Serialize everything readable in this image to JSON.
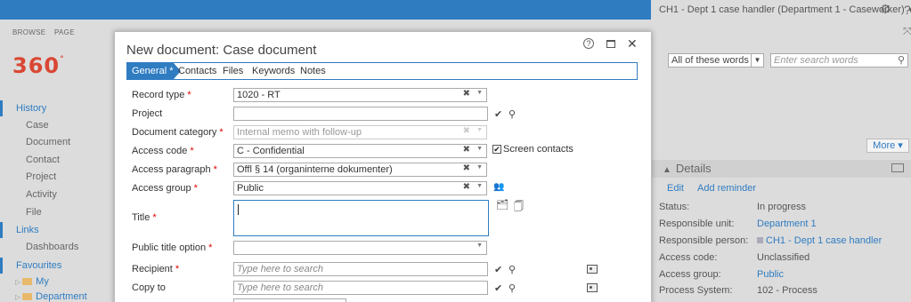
{
  "header": {
    "user_menu": "CH1 - Dept 1 case handler (Department 1 - Caseworker)"
  },
  "ribbon": {
    "tabs": [
      "BROWSE",
      "PAGE"
    ]
  },
  "logo": {
    "text": "360",
    "mark": "°"
  },
  "nav": {
    "history": {
      "label": "History",
      "items": [
        "Case",
        "Document",
        "Contact",
        "Project",
        "Activity",
        "File"
      ]
    },
    "links": {
      "label": "Links",
      "items": [
        "Dashboards"
      ]
    },
    "favourites": {
      "label": "Favourites",
      "items": [
        "My",
        "Department"
      ]
    }
  },
  "search": {
    "mode": "All of these words",
    "placeholder": "Enter search words"
  },
  "more_label": "More",
  "details": {
    "title": "Details",
    "actions": [
      "Edit",
      "Add reminder"
    ],
    "properties": [
      {
        "label": "Status:",
        "value": "In progress"
      },
      {
        "label": "Responsible unit:",
        "value": "Department 1"
      },
      {
        "label": "Responsible person:",
        "value": "CH1 - Dept 1 case handler"
      },
      {
        "label": "Access code:",
        "value": "Unclassified"
      },
      {
        "label": "Access group:",
        "value": "Public"
      },
      {
        "label": "Process System:",
        "value": "102 - Process"
      }
    ]
  },
  "modal": {
    "title": "New document: Case document",
    "tabs": [
      "General *",
      "Contacts",
      "Files",
      "Keywords",
      "Notes"
    ],
    "fields": {
      "record_type": {
        "label": "Record type",
        "value": "1020 - RT"
      },
      "project": {
        "label": "Project",
        "value": ""
      },
      "document_category": {
        "label": "Document category",
        "value": "Internal memo with follow-up"
      },
      "access_code": {
        "label": "Access code",
        "value": "C - Confidential"
      },
      "screen_contacts": {
        "label": "Screen contacts",
        "checked": true
      },
      "access_paragraph": {
        "label": "Access paragraph",
        "value": "Offl § 14 (organinterne dokumenter)"
      },
      "access_group": {
        "label": "Access group",
        "value": "Public"
      },
      "title": {
        "label": "Title",
        "value": ""
      },
      "public_title_option": {
        "label": "Public title option",
        "value": ""
      },
      "recipient": {
        "label": "Recipient",
        "placeholder": "Type here to search"
      },
      "copy_to": {
        "label": "Copy to",
        "placeholder": "Type here to search"
      }
    }
  },
  "colors": {
    "accent": "#2f7cc1",
    "logo": "#d94733",
    "required": "#dd0000"
  }
}
